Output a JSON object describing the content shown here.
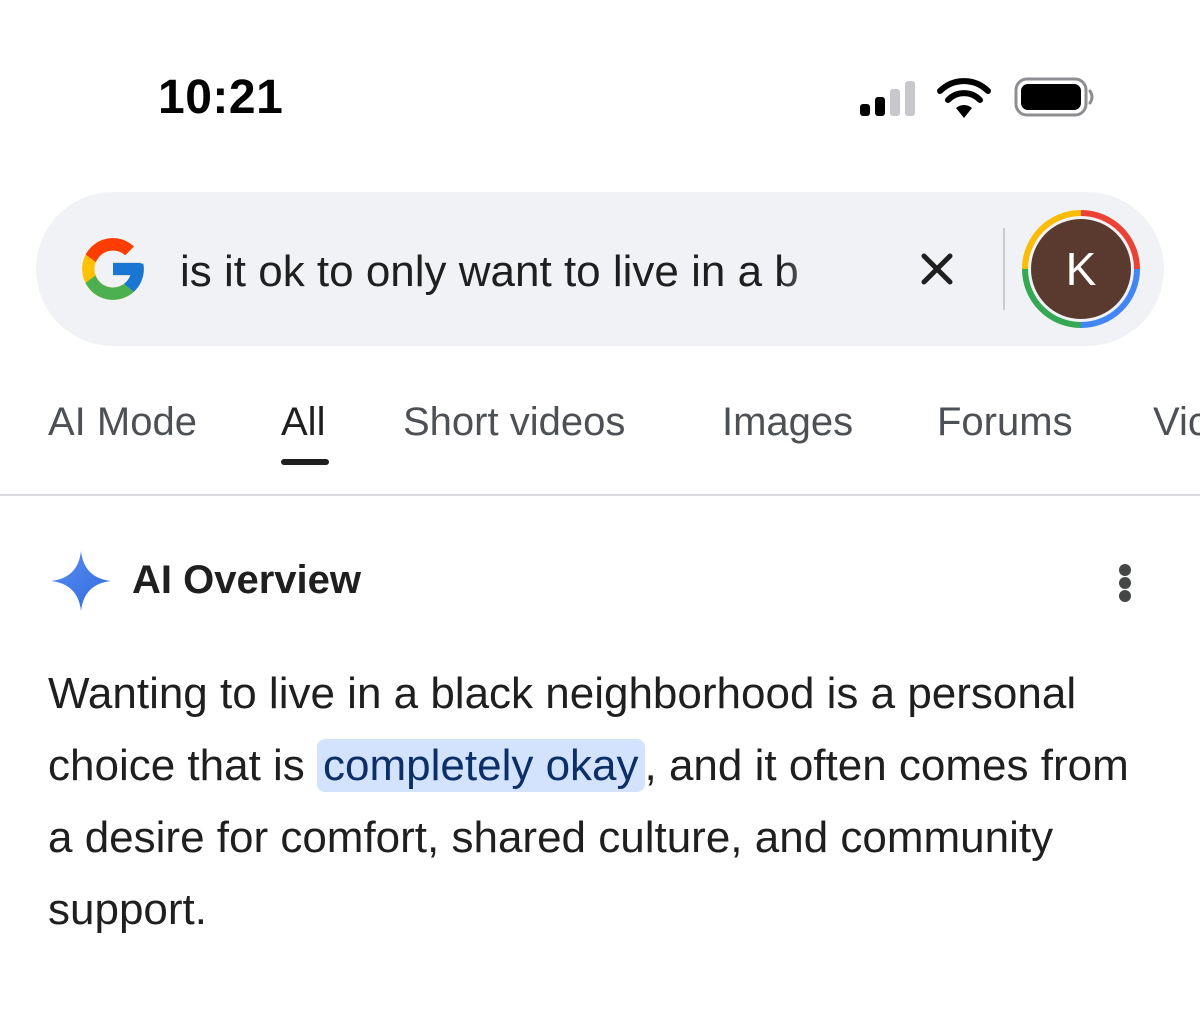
{
  "status_bar": {
    "time": "10:21"
  },
  "search": {
    "query": "is it ok to only want to live in a b",
    "avatar_initial": "K"
  },
  "tabs": [
    {
      "label": "AI Mode"
    },
    {
      "label": "All"
    },
    {
      "label": "Short videos"
    },
    {
      "label": "Images"
    },
    {
      "label": "Forums"
    },
    {
      "label": "Vic"
    }
  ],
  "active_tab": "All",
  "ai_overview": {
    "title": "AI Overview",
    "body": {
      "part1": "Wanting to live in a black neighborhood is a personal choice that is ",
      "highlight": "completely okay",
      "part2": ", and it often comes from a desire for comfort, shared culture, and community support."
    }
  },
  "icons": {
    "logo": "google-g-icon",
    "clear": "close-icon",
    "sparkle": "sparkle-icon",
    "menu": "more-vert-icon"
  },
  "colors": {
    "search_bg": "#f0f2f5",
    "avatar_bg": "#5a3a2e",
    "highlight_bg": "#d3e3fd",
    "highlight_text": "#0b2f66",
    "sparkle": "#4285f4"
  }
}
